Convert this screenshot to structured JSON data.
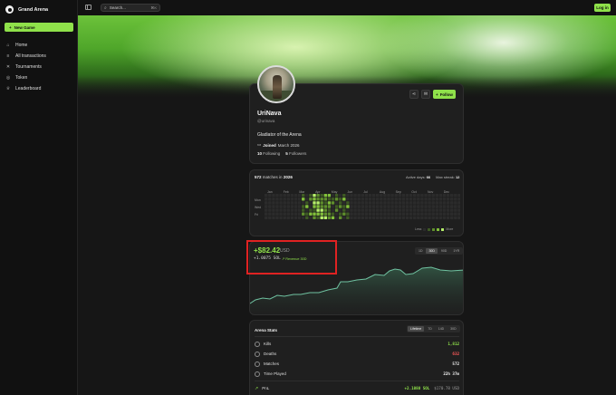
{
  "app": {
    "name": "Grand Arena",
    "new_game": "New Game",
    "login": "Log in"
  },
  "search": {
    "placeholder": "Search...",
    "shortcut": "⌘K"
  },
  "nav": [
    {
      "label": "Home",
      "icon": "home-icon"
    },
    {
      "label": "All transactions",
      "icon": "list-icon"
    },
    {
      "label": "Tournaments",
      "icon": "swords-icon"
    },
    {
      "label": "Token",
      "icon": "token-icon"
    },
    {
      "label": "Leaderboard",
      "icon": "trophy-icon"
    }
  ],
  "profile": {
    "name": "UriNava",
    "handle": "@urinava",
    "bio": "Gladiator of the Arena",
    "joined_label": "Joined",
    "joined_date": "March 2026",
    "following_count": "10",
    "following_label": "Following",
    "followers_count": "5",
    "followers_label": "Followers",
    "follow_button": "Follow"
  },
  "activity": {
    "matches_count": "572",
    "matches_label": "matches in",
    "year": "2026",
    "active_days_label": "Active days:",
    "active_days": "66",
    "max_streak_label": "Max streak:",
    "max_streak": "12",
    "months": [
      "Jan",
      "Feb",
      "Mar",
      "Apr",
      "May",
      "Jun",
      "Jul",
      "Aug",
      "Sep",
      "Oct",
      "Nov",
      "Dec"
    ],
    "day_labels": [
      "Mon",
      "Wed",
      "Fri"
    ],
    "legend_less": "Less",
    "legend_more": "More",
    "colors": [
      "#2b2b2b",
      "#3e5a24",
      "#5f8f2c",
      "#82c13a",
      "#b6f06a"
    ]
  },
  "pnl": {
    "value": "+$82.42",
    "unit": "USD",
    "sol": "+1.0075 SOL",
    "revenue": "↗ Revenue 30D",
    "ranges": [
      "1D",
      "30D",
      "90D",
      "1YR"
    ],
    "active_range": "30D",
    "accent": "#8fe14a"
  },
  "arena_stats": {
    "title": "Arena Stats",
    "tabs": [
      "Lifetime",
      "7D",
      "14D",
      "30D"
    ],
    "active_tab": "Lifetime",
    "rows": [
      {
        "label": "Kills",
        "value": "1,812",
        "color": "#8fe14a"
      },
      {
        "label": "Deaths",
        "value": "632",
        "color": "#ff5a5a"
      },
      {
        "label": "Matches",
        "value": "572",
        "color": "#f0f0f0"
      },
      {
        "label": "Time Played",
        "value": "22h 37m",
        "color": "#f0f0f0"
      }
    ],
    "pnl_label": "PnL",
    "pnl_sol": "+2.1080 SOL",
    "pnl_usd": "$170.78 USD"
  }
}
